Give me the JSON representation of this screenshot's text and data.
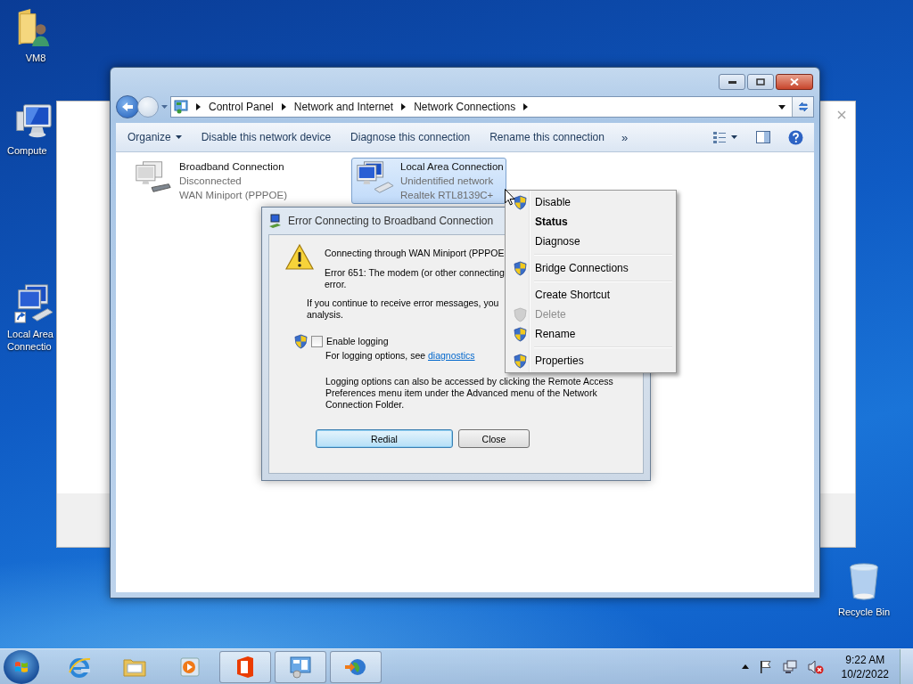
{
  "desktop_icons": [
    {
      "kind": "user-folder",
      "lines": [
        "VM8"
      ]
    },
    {
      "kind": "computer",
      "lines": [
        "Compute"
      ]
    },
    {
      "kind": "network-shortcut",
      "lines": [
        "Local Area",
        "Connectio"
      ]
    }
  ],
  "recycle_bin": {
    "label": "Recycle Bin"
  },
  "explorer": {
    "breadcrumbs": [
      "Control Panel",
      "Network and Internet",
      "Network Connections"
    ],
    "toolbar": [
      {
        "label": "Organize",
        "dropdown": true
      },
      {
        "label": "Disable this network device",
        "dropdown": false
      },
      {
        "label": "Diagnose this connection",
        "dropdown": false
      },
      {
        "label": "Rename this connection",
        "dropdown": false
      }
    ],
    "overflow": "»",
    "connections": [
      {
        "kind": "modem",
        "name": "Broadband Connection",
        "status": "Disconnected",
        "device": "WAN Miniport (PPPOE)",
        "selected": false
      },
      {
        "kind": "ethernet",
        "name": "Local Area Connection",
        "status": "Unidentified network",
        "device": "Realtek RTL8139C+",
        "selected": true
      }
    ]
  },
  "dialog": {
    "title": "Error Connecting to Broadband Connection",
    "message_lines": [
      "Connecting through WAN Miniport (PPPOE"
    ],
    "error_lines": [
      "Error 651: The modem (or other connecting",
      "error."
    ],
    "advice_lines": [
      "If you continue to receive error messages, you",
      "analysis."
    ],
    "logging": {
      "label": "Enable logging",
      "checked": false
    },
    "hint": "For logging options, see",
    "hint_link": "diagnostics",
    "note": "Logging options can also be accessed by clicking the Remote Access Preferences menu item under the Advanced menu of the Network Connection Folder.",
    "buttons": [
      {
        "label": "Redial",
        "default": true
      },
      {
        "label": "Close",
        "default": false
      }
    ]
  },
  "context_menu": {
    "groups": [
      [
        {
          "label": "Disable",
          "shield": true,
          "bold": false,
          "disabled": false
        },
        {
          "label": "Status",
          "shield": false,
          "bold": true,
          "disabled": false
        },
        {
          "label": "Diagnose",
          "shield": false,
          "bold": false,
          "disabled": false
        }
      ],
      [
        {
          "label": "Bridge Connections",
          "shield": true,
          "bold": false,
          "disabled": false
        }
      ],
      [
        {
          "label": "Create Shortcut",
          "shield": false,
          "bold": false,
          "disabled": false
        },
        {
          "label": "Delete",
          "shield": true,
          "bold": false,
          "disabled": true
        },
        {
          "label": "Rename",
          "shield": true,
          "bold": false,
          "disabled": false
        }
      ],
      [
        {
          "label": "Properties",
          "shield": true,
          "bold": false,
          "disabled": false
        }
      ]
    ]
  },
  "taskbar": {
    "apps": [
      {
        "kind": "browser",
        "open": false
      },
      {
        "kind": "folder",
        "open": false
      },
      {
        "kind": "media",
        "open": false
      },
      {
        "kind": "office",
        "open": true
      },
      {
        "kind": "control-panel",
        "open": true
      },
      {
        "kind": "network",
        "open": true
      }
    ],
    "time": "9:22 AM",
    "date": "10/2/2022"
  }
}
